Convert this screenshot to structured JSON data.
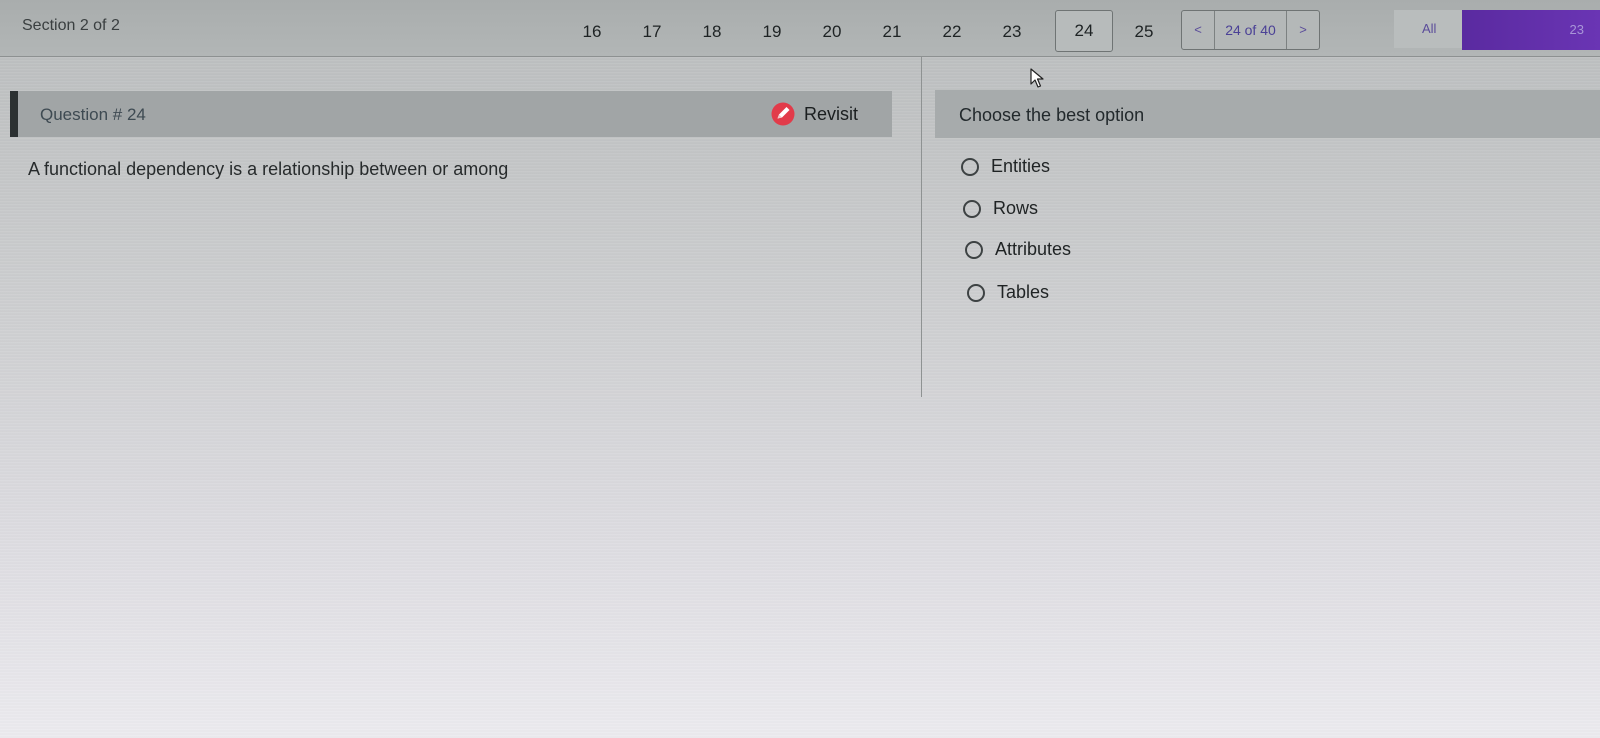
{
  "header": {
    "section_label": "Section 2 of 2",
    "question_numbers": [
      "16",
      "17",
      "18",
      "19",
      "20",
      "21",
      "22",
      "23",
      "24",
      "25"
    ],
    "current_question": "24",
    "pager": {
      "prev_label": "<",
      "count_label": "24 of 40",
      "next_label": ">"
    },
    "filter_label": "All",
    "count_badge": "23",
    "accent_color": "#5a2aa0"
  },
  "question": {
    "title": "Question # 24",
    "revisit_label": "Revisit",
    "revisit_icon": "edit-badge-icon",
    "text": "A functional dependency is a relationship between or among"
  },
  "answers": {
    "heading": "Choose the best option",
    "options": [
      "Entities",
      "Rows",
      "Attributes",
      "Tables"
    ]
  }
}
